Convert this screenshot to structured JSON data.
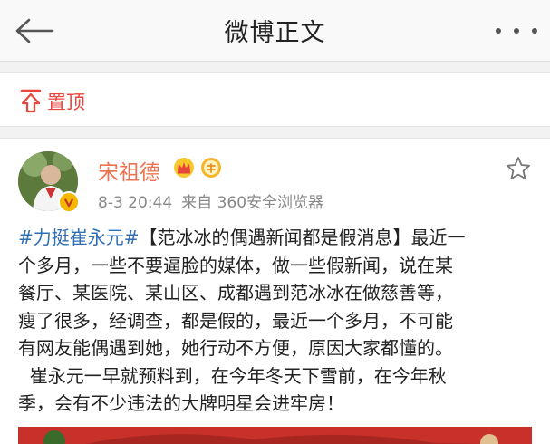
{
  "header": {
    "title": "微博正文"
  },
  "pin": {
    "label": "置顶"
  },
  "post": {
    "username": "宋祖德",
    "time": "8-3 20:44",
    "source": "来自 360安全浏览器",
    "topic": "#力挺崔永元#",
    "lines": [
      "【范冰冰的偶遇新闻都是假消息】最近一",
      "个多月，一些不要逼脸的媒体，做一些假新闻，说在某",
      "餐厅、某医院、某山区、成都遇到范冰冰在做慈善等，",
      "瘦了很多，经调查，都是假的，最近一个多月，不可能",
      "有网友能偶遇到她，她行动不方便，原因大家都懂的。",
      "  崔永元一早就预料到，在今年冬天下雪前，在今年秋",
      "季，会有不少违法的大牌明星会进牢房！"
    ]
  },
  "icons": {
    "back": "arrow-left-icon",
    "more": "more-dots-icon",
    "pin": "pin-top-icon",
    "verified": "verified-v-icon",
    "crown": "crown-icon",
    "member": "member-icon",
    "favorite": "star-icon"
  },
  "colors": {
    "accent": "#eb7350",
    "link": "#2e6eb5",
    "pin": "#e8463c"
  }
}
